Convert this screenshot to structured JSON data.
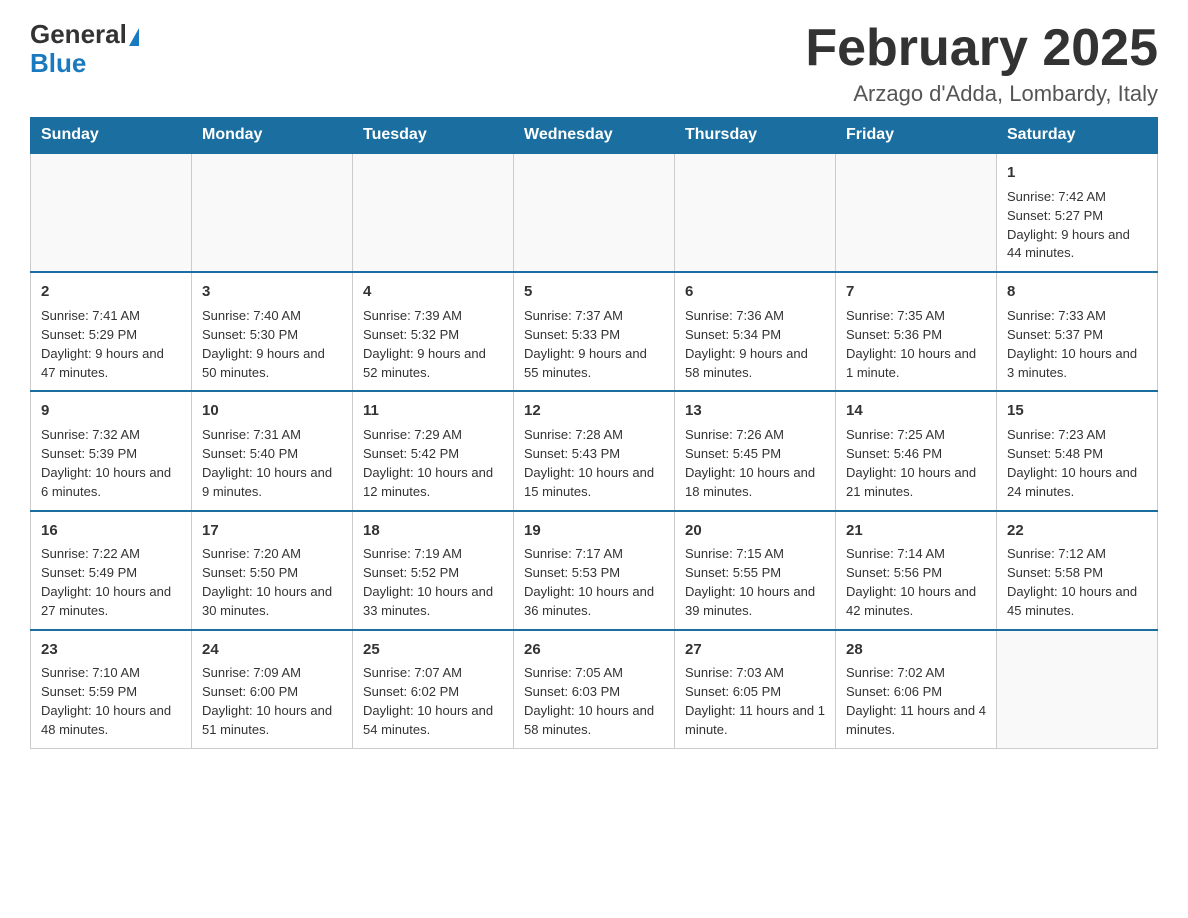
{
  "header": {
    "logo_general": "General",
    "logo_blue": "Blue",
    "title": "February 2025",
    "subtitle": "Arzago d'Adda, Lombardy, Italy"
  },
  "weekdays": [
    "Sunday",
    "Monday",
    "Tuesday",
    "Wednesday",
    "Thursday",
    "Friday",
    "Saturday"
  ],
  "weeks": [
    [
      {
        "day": "",
        "info": ""
      },
      {
        "day": "",
        "info": ""
      },
      {
        "day": "",
        "info": ""
      },
      {
        "day": "",
        "info": ""
      },
      {
        "day": "",
        "info": ""
      },
      {
        "day": "",
        "info": ""
      },
      {
        "day": "1",
        "info": "Sunrise: 7:42 AM\nSunset: 5:27 PM\nDaylight: 9 hours and 44 minutes."
      }
    ],
    [
      {
        "day": "2",
        "info": "Sunrise: 7:41 AM\nSunset: 5:29 PM\nDaylight: 9 hours and 47 minutes."
      },
      {
        "day": "3",
        "info": "Sunrise: 7:40 AM\nSunset: 5:30 PM\nDaylight: 9 hours and 50 minutes."
      },
      {
        "day": "4",
        "info": "Sunrise: 7:39 AM\nSunset: 5:32 PM\nDaylight: 9 hours and 52 minutes."
      },
      {
        "day": "5",
        "info": "Sunrise: 7:37 AM\nSunset: 5:33 PM\nDaylight: 9 hours and 55 minutes."
      },
      {
        "day": "6",
        "info": "Sunrise: 7:36 AM\nSunset: 5:34 PM\nDaylight: 9 hours and 58 minutes."
      },
      {
        "day": "7",
        "info": "Sunrise: 7:35 AM\nSunset: 5:36 PM\nDaylight: 10 hours and 1 minute."
      },
      {
        "day": "8",
        "info": "Sunrise: 7:33 AM\nSunset: 5:37 PM\nDaylight: 10 hours and 3 minutes."
      }
    ],
    [
      {
        "day": "9",
        "info": "Sunrise: 7:32 AM\nSunset: 5:39 PM\nDaylight: 10 hours and 6 minutes."
      },
      {
        "day": "10",
        "info": "Sunrise: 7:31 AM\nSunset: 5:40 PM\nDaylight: 10 hours and 9 minutes."
      },
      {
        "day": "11",
        "info": "Sunrise: 7:29 AM\nSunset: 5:42 PM\nDaylight: 10 hours and 12 minutes."
      },
      {
        "day": "12",
        "info": "Sunrise: 7:28 AM\nSunset: 5:43 PM\nDaylight: 10 hours and 15 minutes."
      },
      {
        "day": "13",
        "info": "Sunrise: 7:26 AM\nSunset: 5:45 PM\nDaylight: 10 hours and 18 minutes."
      },
      {
        "day": "14",
        "info": "Sunrise: 7:25 AM\nSunset: 5:46 PM\nDaylight: 10 hours and 21 minutes."
      },
      {
        "day": "15",
        "info": "Sunrise: 7:23 AM\nSunset: 5:48 PM\nDaylight: 10 hours and 24 minutes."
      }
    ],
    [
      {
        "day": "16",
        "info": "Sunrise: 7:22 AM\nSunset: 5:49 PM\nDaylight: 10 hours and 27 minutes."
      },
      {
        "day": "17",
        "info": "Sunrise: 7:20 AM\nSunset: 5:50 PM\nDaylight: 10 hours and 30 minutes."
      },
      {
        "day": "18",
        "info": "Sunrise: 7:19 AM\nSunset: 5:52 PM\nDaylight: 10 hours and 33 minutes."
      },
      {
        "day": "19",
        "info": "Sunrise: 7:17 AM\nSunset: 5:53 PM\nDaylight: 10 hours and 36 minutes."
      },
      {
        "day": "20",
        "info": "Sunrise: 7:15 AM\nSunset: 5:55 PM\nDaylight: 10 hours and 39 minutes."
      },
      {
        "day": "21",
        "info": "Sunrise: 7:14 AM\nSunset: 5:56 PM\nDaylight: 10 hours and 42 minutes."
      },
      {
        "day": "22",
        "info": "Sunrise: 7:12 AM\nSunset: 5:58 PM\nDaylight: 10 hours and 45 minutes."
      }
    ],
    [
      {
        "day": "23",
        "info": "Sunrise: 7:10 AM\nSunset: 5:59 PM\nDaylight: 10 hours and 48 minutes."
      },
      {
        "day": "24",
        "info": "Sunrise: 7:09 AM\nSunset: 6:00 PM\nDaylight: 10 hours and 51 minutes."
      },
      {
        "day": "25",
        "info": "Sunrise: 7:07 AM\nSunset: 6:02 PM\nDaylight: 10 hours and 54 minutes."
      },
      {
        "day": "26",
        "info": "Sunrise: 7:05 AM\nSunset: 6:03 PM\nDaylight: 10 hours and 58 minutes."
      },
      {
        "day": "27",
        "info": "Sunrise: 7:03 AM\nSunset: 6:05 PM\nDaylight: 11 hours and 1 minute."
      },
      {
        "day": "28",
        "info": "Sunrise: 7:02 AM\nSunset: 6:06 PM\nDaylight: 11 hours and 4 minutes."
      },
      {
        "day": "",
        "info": ""
      }
    ]
  ]
}
